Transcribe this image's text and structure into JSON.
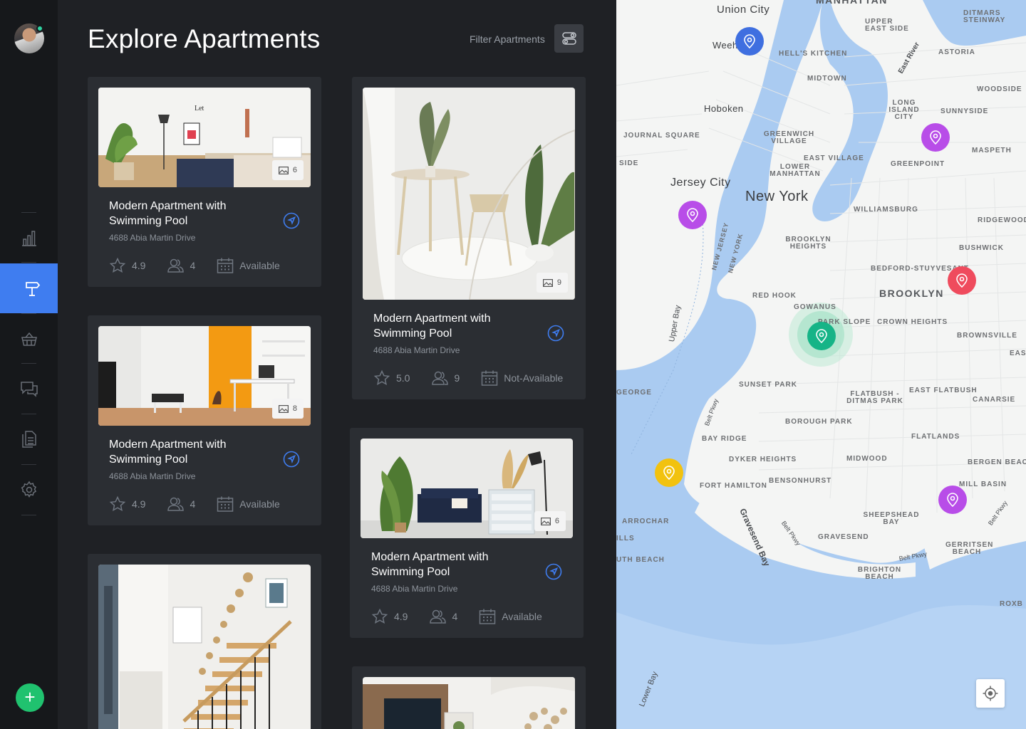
{
  "header": {
    "title": "Explore Apartments",
    "filter_label": "Filter Apartments"
  },
  "sidebar": {
    "items": [
      {
        "icon": "bar-chart-icon"
      },
      {
        "icon": "signpost-icon",
        "active": true
      },
      {
        "icon": "basket-icon"
      },
      {
        "icon": "chat-icon"
      },
      {
        "icon": "documents-icon"
      },
      {
        "icon": "gear-icon"
      }
    ],
    "add_label": "+"
  },
  "listings": [
    {
      "title": "Modern Apartment with Swimming Pool",
      "address": "4688 Abia Martin Drive",
      "rating": "4.9",
      "guests": "4",
      "status": "Available",
      "photos": "6"
    },
    {
      "title": "Modern Apartment with Swimming Pool",
      "address": "4688 Abia Martin Drive",
      "rating": "5.0",
      "guests": "9",
      "status": "Not-Available",
      "photos": "9"
    },
    {
      "title": "Modern Apartment with Swimming Pool",
      "address": "4688 Abia Martin Drive",
      "rating": "4.9",
      "guests": "4",
      "status": "Available",
      "photos": "8"
    },
    {
      "title": "Modern Apartment with Swimming Pool",
      "address": "4688 Abia Martin Drive",
      "rating": "4.9",
      "guests": "4",
      "status": "Available",
      "photos": "6"
    }
  ],
  "map": {
    "labels": {
      "union_city": "Union City",
      "weehawken": "Weeh",
      "manhattan": "MANHATTAN",
      "upper_east_side": "UPPER EAST SIDE",
      "hells_kitchen": "HELL'S KITCHEN",
      "astoria": "ASTORIA",
      "ditmars": "DITMARS STEINWAY",
      "midtown": "MIDTOWN",
      "woodside": "WOODSIDE",
      "hoboken": "Hoboken",
      "long_island_city": "LONG ISLAND CITY",
      "sunnyside": "SUNNYSIDE",
      "journal_square": "JOURNAL SQUARE",
      "greenwich": "GREENWICH VILLAGE",
      "maspeth": "MASPETH",
      "side": "SIDE",
      "east_village": "EAST VILLAGE",
      "greenpoint": "GREENPOINT",
      "lower_manhattan": "LOWER MANHATTAN",
      "jersey_city": "Jersey City",
      "new_york": "New York",
      "williamsburg": "WILLIAMSBURG",
      "ridgewood": "RIDGEWOOD",
      "brooklyn_heights": "BROOKLYN HEIGHTS",
      "bushwick": "BUSHWICK",
      "bedford": "BEDFORD-STUYVESANT",
      "red_hook": "RED HOOK",
      "brooklyn": "BROOKLYN",
      "gowanus": "GOWANUS",
      "park_slope": "PARK SLOPE",
      "crown_heights": "CROWN HEIGHTS",
      "brownsville": "BROWNSVILLE",
      "upper_bay": "Upper Bay",
      "sunset_park": "SUNSET PARK",
      "east_flatbush": "EAST FLATBUSH",
      "george": "GEORGE",
      "flatbush": "FLATBUSH - DITMAS PARK",
      "canarsie": "CANARSIE",
      "borough_park": "BOROUGH PARK",
      "bay_ridge": "BAY RIDGE",
      "flatlands": "FLATLANDS",
      "dyker_heights": "DYKER HEIGHTS",
      "midwood": "MIDWOOD",
      "bergen_beach": "BERGEN BEACH",
      "bensonhurst": "BENSONHURST",
      "fort_hamilton": "FORT HAMILTON",
      "mill_basin": "MILL BASIN",
      "arrochar": "ARROCHAR",
      "sheepshead": "SHEEPSHEAD BAY",
      "gravesend": "GRAVESEND",
      "gravesend_bay": "Gravesend Bay",
      "ills": "ILLS",
      "gerritsen": "GERRITSEN BEACH",
      "south_beach": "UTH BEACH",
      "brighton": "BRIGHTON BEACH",
      "lower_bay": "Lower Bay",
      "new_jersey": "NEW JERSEY",
      "new_york_state": "NEW YORK",
      "belt_pkwy": "Belt Pkwy",
      "east_river": "East River",
      "roxb": "ROXB",
      "east": "EAS"
    },
    "pins": [
      {
        "color": "#3f6fe0",
        "name": "pin-blue"
      },
      {
        "color": "#b84de8",
        "name": "pin-purple"
      },
      {
        "color": "#b84de8",
        "name": "pin-purple"
      },
      {
        "color": "#ef4b5d",
        "name": "pin-red"
      },
      {
        "color": "#16b487",
        "name": "pin-green-selected"
      },
      {
        "color": "#f2c20f",
        "name": "pin-yellow"
      },
      {
        "color": "#b84de8",
        "name": "pin-purple"
      }
    ]
  }
}
